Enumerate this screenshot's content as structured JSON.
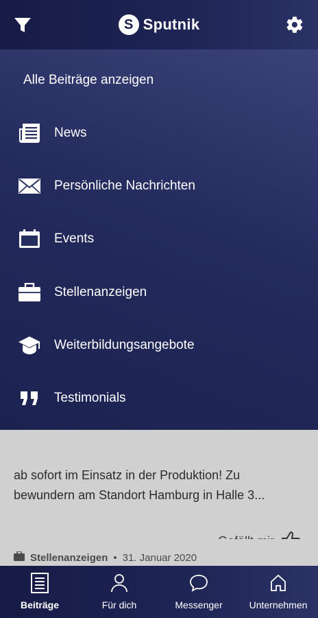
{
  "header": {
    "brand": "Sputnik",
    "logo_letter": "S"
  },
  "filter_menu": {
    "all_label": "Alle Beiträge anzeigen",
    "items": [
      {
        "label": "News",
        "icon": "newspaper-icon"
      },
      {
        "label": "Persönliche Nachrichten",
        "icon": "envelope-icon"
      },
      {
        "label": "Events",
        "icon": "calendar-icon"
      },
      {
        "label": "Stellenanzeigen",
        "icon": "briefcase-icon"
      },
      {
        "label": "Weiterbildungsangebote",
        "icon": "graduation-cap-icon"
      },
      {
        "label": "Testimonials",
        "icon": "quote-icon"
      }
    ]
  },
  "feed": {
    "post_text": "ab sofort im Einsatz in der Produktion! Zu bewundern am Standort Hamburg in Halle 3...",
    "like_label": "Gefällt mir",
    "next_post": {
      "category": "Stellenanzeigen",
      "separator": "•",
      "date": "31. Januar 2020"
    }
  },
  "bottom_nav": {
    "items": [
      {
        "label": "Beiträge",
        "icon": "posts-icon",
        "active": true
      },
      {
        "label": "Für dich",
        "icon": "person-icon",
        "active": false
      },
      {
        "label": "Messenger",
        "icon": "chat-bubble-icon",
        "active": false
      },
      {
        "label": "Unternehmen",
        "icon": "home-icon",
        "active": false
      }
    ]
  },
  "colors": {
    "primary_dark": "#1c2250",
    "drawer_light": "#3a4278",
    "text_on_dark": "#ffffff"
  }
}
